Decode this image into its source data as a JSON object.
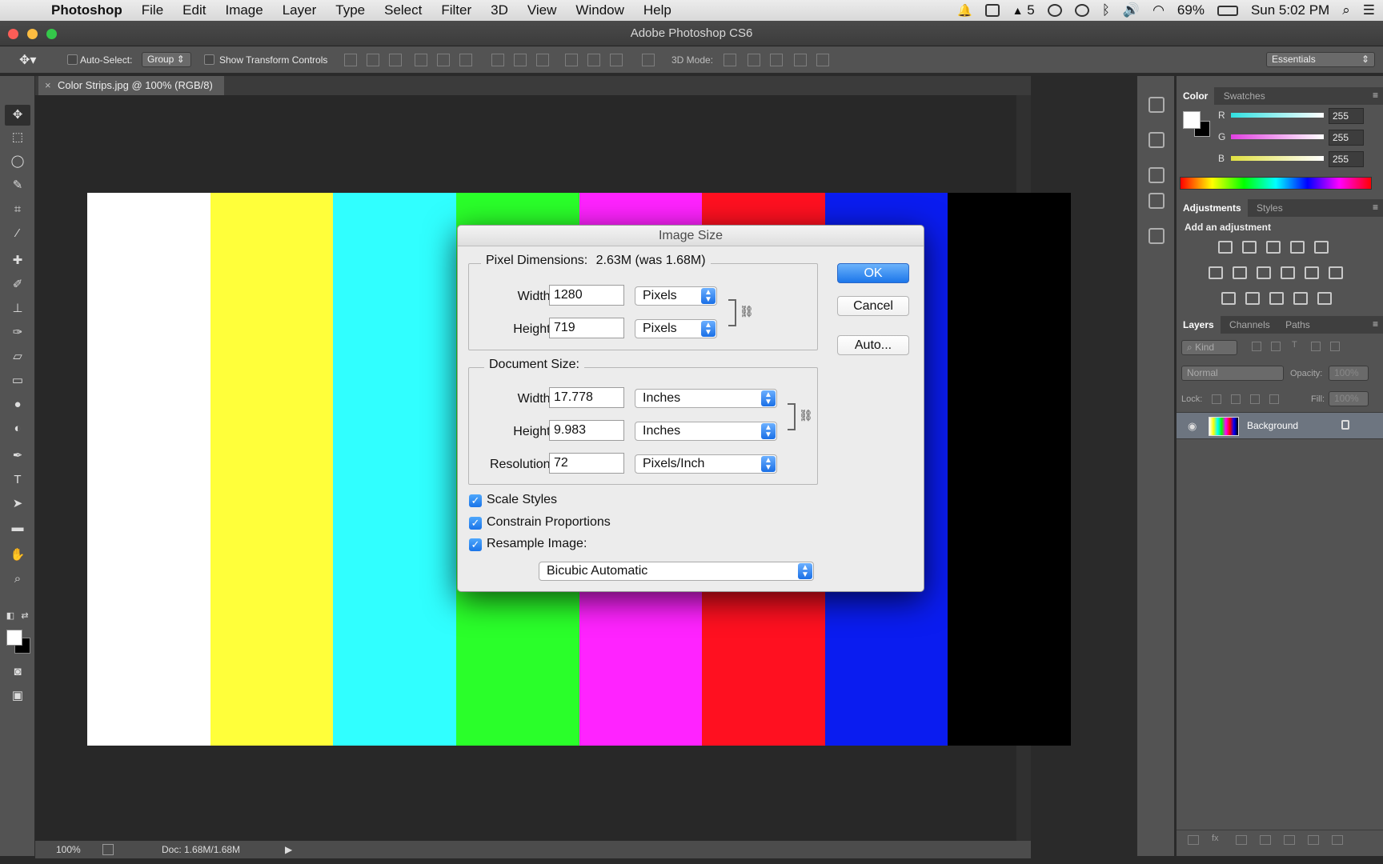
{
  "menubar": {
    "app": "Photoshop",
    "items": [
      "File",
      "Edit",
      "Image",
      "Layer",
      "Type",
      "Select",
      "Filter",
      "3D",
      "View",
      "Window",
      "Help"
    ],
    "status": {
      "badge": "5",
      "battery": "69%",
      "clock": "Sun 5:02 PM"
    }
  },
  "window": {
    "title": "Adobe Photoshop CS6"
  },
  "options": {
    "auto_select_label": "Auto-Select:",
    "auto_select_value": "Group",
    "transform_label": "Show Transform Controls",
    "mode3d_label": "3D Mode:",
    "workspace": "Essentials"
  },
  "document": {
    "tab_title": "Color Strips.jpg @ 100% (RGB/8)",
    "strip_colors": [
      "#ffffff",
      "#ffff3a",
      "#30ffff",
      "#2aff2a",
      "#ff23ff",
      "#ff1020",
      "#0a1cf0",
      "#000000"
    ]
  },
  "status": {
    "zoom": "100%",
    "doc": "Doc: 1.68M/1.68M"
  },
  "color_panel": {
    "tabs": [
      "Color",
      "Swatches"
    ],
    "channels": [
      {
        "label": "R",
        "value": "255",
        "color": "#30e0e0"
      },
      {
        "label": "G",
        "value": "255",
        "color": "#e040e0"
      },
      {
        "label": "B",
        "value": "255",
        "color": "#e0e040"
      }
    ]
  },
  "adjustments_panel": {
    "tabs": [
      "Adjustments",
      "Styles"
    ],
    "hint": "Add an adjustment"
  },
  "layers_panel": {
    "tabs": [
      "Layers",
      "Channels",
      "Paths"
    ],
    "filter": "Kind",
    "blend_mode": "Normal",
    "opacity_label": "Opacity:",
    "opacity_value": "100%",
    "lock_label": "Lock:",
    "fill_label": "Fill:",
    "fill_value": "100%",
    "layer_name": "Background"
  },
  "dialog": {
    "title": "Image Size",
    "pixel_dims_label": "Pixel Dimensions:",
    "pixel_dims_value": "2.63M (was 1.68M)",
    "pixel_width_label": "Width:",
    "pixel_width": "1280",
    "pixel_width_unit": "Pixels",
    "pixel_height_label": "Height:",
    "pixel_height": "719",
    "pixel_height_unit": "Pixels",
    "doc_size_label": "Document Size:",
    "doc_width_label": "Width:",
    "doc_width": "17.778",
    "doc_width_unit": "Inches",
    "doc_height_label": "Height:",
    "doc_height": "9.983",
    "doc_height_unit": "Inches",
    "resolution_label": "Resolution:",
    "resolution": "72",
    "resolution_unit": "Pixels/Inch",
    "scale_styles": "Scale Styles",
    "constrain": "Constrain Proportions",
    "resample": "Resample Image:",
    "resample_method": "Bicubic Automatic",
    "ok": "OK",
    "cancel": "Cancel",
    "auto": "Auto..."
  }
}
